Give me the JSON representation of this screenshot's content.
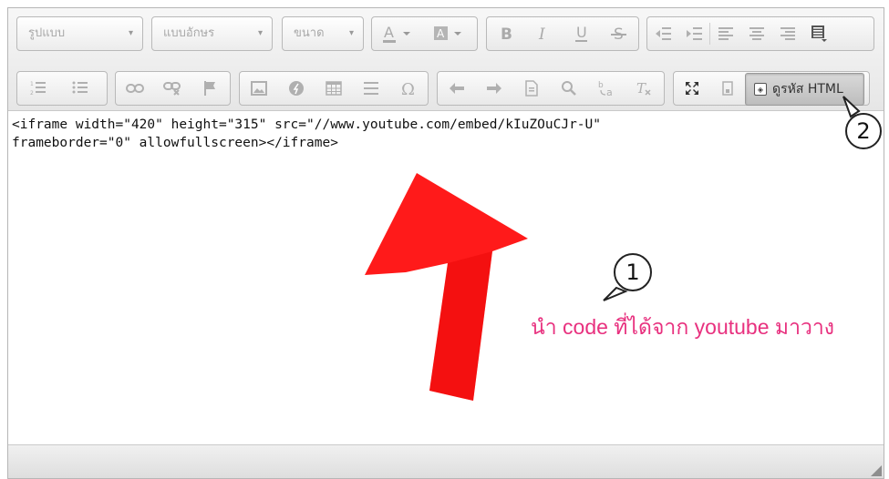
{
  "toolbar": {
    "format_combo": "รูปแบบ",
    "font_combo": "แบบอักษร",
    "size_combo": "ขนาด",
    "combo_arrow": "▾",
    "source_button": "ดูรหัส HTML"
  },
  "editor_content": {
    "line1": "<iframe width=\"420\" height=\"315\" src=\"//www.youtube.com/embed/kIuZOuCJr-U\"",
    "line2": "frameborder=\"0\" allowfullscreen></iframe>"
  },
  "annotations": {
    "callout1": "1",
    "callout2": "2",
    "note": "นำ code ที่ได้จาก youtube มาวาง",
    "arrow_color": "#ff1a1a",
    "note_color": "#e8317f"
  },
  "icons": {
    "text_color": "text-color-icon",
    "bg_color": "background-color-icon",
    "bold": "bold-icon",
    "italic": "italic-icon",
    "underline": "underline-icon",
    "strike": "strikethrough-icon",
    "source": "source-icon"
  }
}
